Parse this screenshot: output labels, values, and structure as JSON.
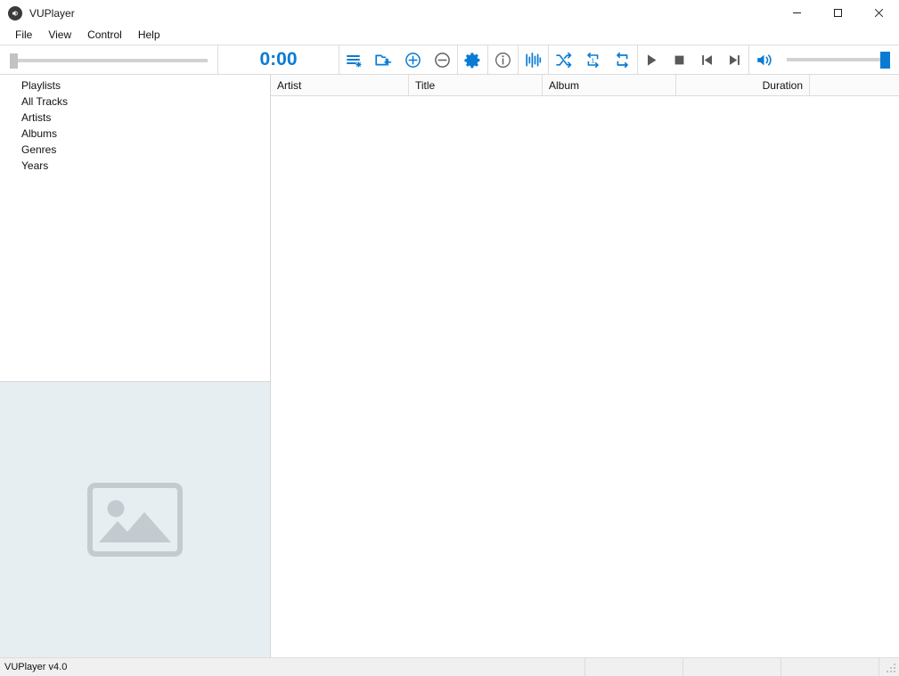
{
  "window": {
    "title": "VUPlayer",
    "icon": "speaker-icon",
    "minimize_label": "Minimize",
    "maximize_label": "Maximize",
    "close_label": "Close"
  },
  "menubar": {
    "items": [
      {
        "label": "File"
      },
      {
        "label": "View"
      },
      {
        "label": "Control"
      },
      {
        "label": "Help"
      }
    ]
  },
  "toolbar": {
    "seek": {
      "value": 0,
      "min": 0,
      "max": 100
    },
    "time": "0:00",
    "buttons": [
      {
        "name": "new-playlist-button",
        "icon": "new-playlist-icon",
        "label": "New Playlist"
      },
      {
        "name": "add-folder-button",
        "icon": "add-folder-icon",
        "label": "Add Folder"
      },
      {
        "name": "add-files-button",
        "icon": "plus-circle-icon",
        "label": "Add Files"
      },
      {
        "name": "remove-files-button",
        "icon": "minus-circle-icon",
        "label": "Remove Files"
      },
      {
        "name": "options-button",
        "icon": "gear-icon",
        "label": "Options"
      },
      {
        "name": "track-information-button",
        "icon": "info-circle-icon",
        "label": "Track Information"
      },
      {
        "name": "visualisation-button",
        "icon": "equalizer-bars-icon",
        "label": "Visualisation"
      },
      {
        "name": "shuffle-button",
        "icon": "shuffle-icon",
        "label": "Random Play"
      },
      {
        "name": "repeat-track-button",
        "icon": "repeat-one-icon",
        "label": "Repeat Track"
      },
      {
        "name": "repeat-playlist-button",
        "icon": "repeat-all-icon",
        "label": "Repeat Playlist"
      },
      {
        "name": "play-button",
        "icon": "play-icon",
        "label": "Play"
      },
      {
        "name": "stop-button",
        "icon": "stop-icon",
        "label": "Stop"
      },
      {
        "name": "previous-button",
        "icon": "previous-track-icon",
        "label": "Previous Track"
      },
      {
        "name": "next-button",
        "icon": "next-track-icon",
        "label": "Next Track"
      }
    ],
    "volume": {
      "icon": "volume-icon",
      "value": 100,
      "min": 0,
      "max": 100
    }
  },
  "sidebar": {
    "items": [
      {
        "label": "Playlists"
      },
      {
        "label": "All Tracks"
      },
      {
        "label": "Artists"
      },
      {
        "label": "Albums"
      },
      {
        "label": "Genres"
      },
      {
        "label": "Years"
      }
    ],
    "artwork": {
      "icon": "image-placeholder-icon",
      "alt": "No album artwork"
    }
  },
  "playlist": {
    "columns": [
      {
        "label": "Artist",
        "align": "left"
      },
      {
        "label": "Title",
        "align": "left"
      },
      {
        "label": "Album",
        "align": "left"
      },
      {
        "label": "Duration",
        "align": "right"
      }
    ],
    "rows": []
  },
  "statusbar": {
    "main": "VUPlayer v4.0",
    "segment_a": "",
    "segment_b": "",
    "segment_c": ""
  },
  "colors": {
    "accent": "#0a7bd4",
    "transport": "#595959",
    "art_panel_bg": "#e7eef2",
    "placeholder": "#c4cbd0"
  }
}
